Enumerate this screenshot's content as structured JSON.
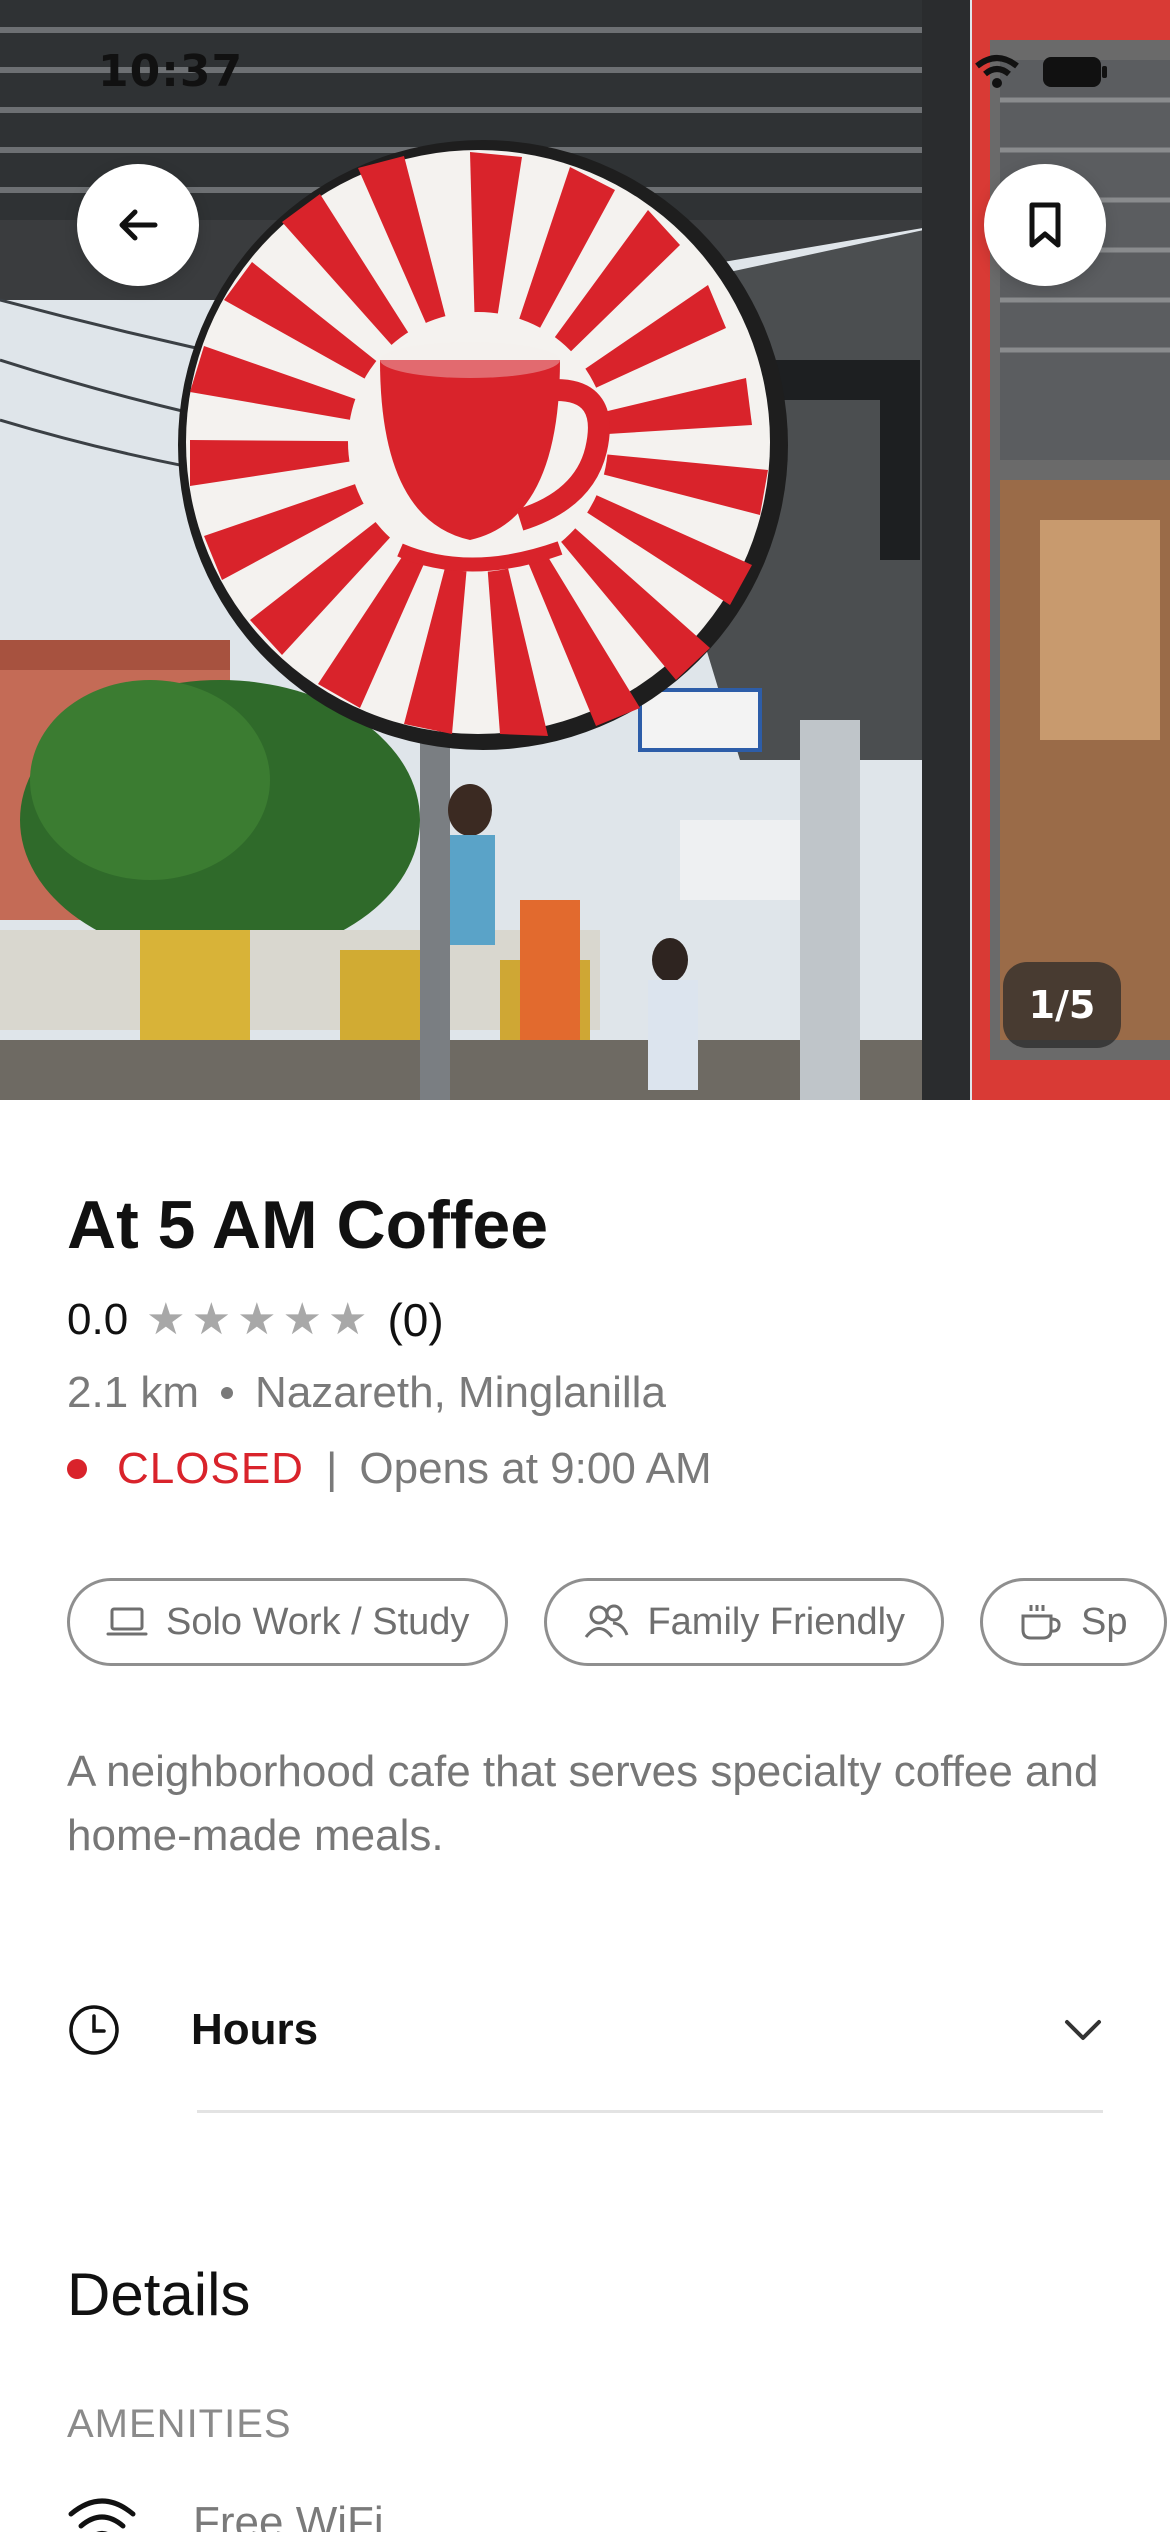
{
  "status_bar": {
    "time": "10:37"
  },
  "gallery": {
    "counter": "1/5"
  },
  "place": {
    "name": "At 5 AM Coffee",
    "rating_value": "0.0",
    "stars": 0,
    "rating_count": "(0)",
    "distance": "2.1 km",
    "location": "Nazareth, Minglanilla",
    "status": "CLOSED",
    "separator": "|",
    "opens": "Opens at 9:00 AM",
    "description": "A neighborhood cafe that serves specialty coffee and home-made meals."
  },
  "tags": [
    {
      "label": "Solo Work / Study",
      "icon": "laptop-icon"
    },
    {
      "label": "Family Friendly",
      "icon": "users-icon"
    },
    {
      "label": "Sp",
      "icon": "coffee-cup-icon"
    }
  ],
  "hours": {
    "label": "Hours"
  },
  "details": {
    "title": "Details",
    "amenities_label": "AMENITIES",
    "amenities": [
      {
        "label": "Free WiFi",
        "icon": "wifi-icon"
      }
    ]
  },
  "colors": {
    "closed": "#d9232b",
    "sign_red": "#d9232b",
    "muted_text": "#7a7a7a"
  }
}
